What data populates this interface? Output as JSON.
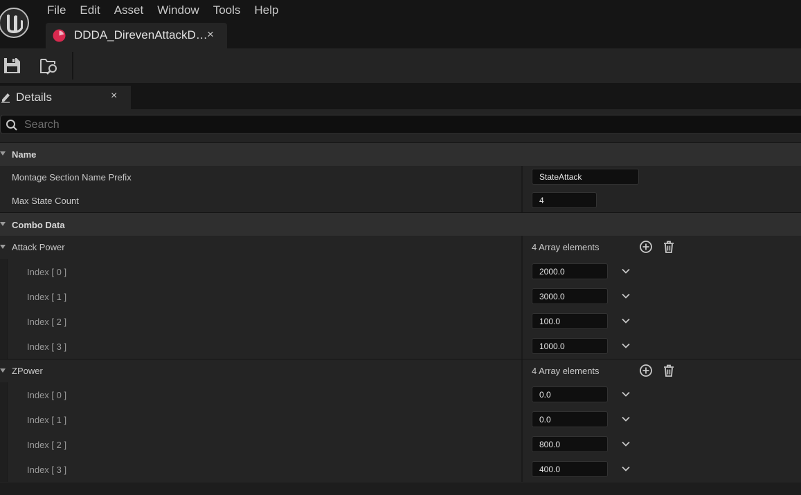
{
  "menu": [
    "File",
    "Edit",
    "Asset",
    "Window",
    "Tools",
    "Help"
  ],
  "document_tab": {
    "title": "DDDA_DirevenAttackD…",
    "close": "×"
  },
  "details_tab": {
    "title": "Details",
    "close": "×"
  },
  "search": {
    "placeholder": "Search",
    "value": ""
  },
  "categories": {
    "name": {
      "label": "Name"
    },
    "combo_data": {
      "label": "Combo Data"
    }
  },
  "properties": {
    "montage_prefix": {
      "label": "Montage Section Name Prefix",
      "value": "StateAttack"
    },
    "max_state_count": {
      "label": "Max State Count",
      "value": "4"
    }
  },
  "arrays": {
    "attack_power": {
      "label": "Attack Power",
      "count": "4 Array elements",
      "items": [
        {
          "label": "Index [ 0 ]",
          "value": "2000.0"
        },
        {
          "label": "Index [ 1 ]",
          "value": "3000.0"
        },
        {
          "label": "Index [ 2 ]",
          "value": "100.0"
        },
        {
          "label": "Index [ 3 ]",
          "value": "1000.0"
        }
      ]
    },
    "zpower": {
      "label": "ZPower",
      "count": "4 Array elements",
      "items": [
        {
          "label": "Index [ 0 ]",
          "value": "0.0"
        },
        {
          "label": "Index [ 1 ]",
          "value": "0.0"
        },
        {
          "label": "Index [ 2 ]",
          "value": "800.0"
        },
        {
          "label": "Index [ 3 ]",
          "value": "400.0"
        }
      ]
    }
  },
  "icons": {
    "logo": "unreal-logo-icon",
    "asset": "data-asset-icon",
    "save": "save-icon",
    "browse": "browse-to-asset-icon",
    "edit": "pencil-icon",
    "search": "search-icon",
    "add": "add-element-icon",
    "delete": "trash-icon",
    "chevron": "chevron-down-icon"
  },
  "colors": {
    "asset_icon": "#d8294f",
    "panel_bg": "#242424",
    "input_bg": "#0f0f0f"
  }
}
